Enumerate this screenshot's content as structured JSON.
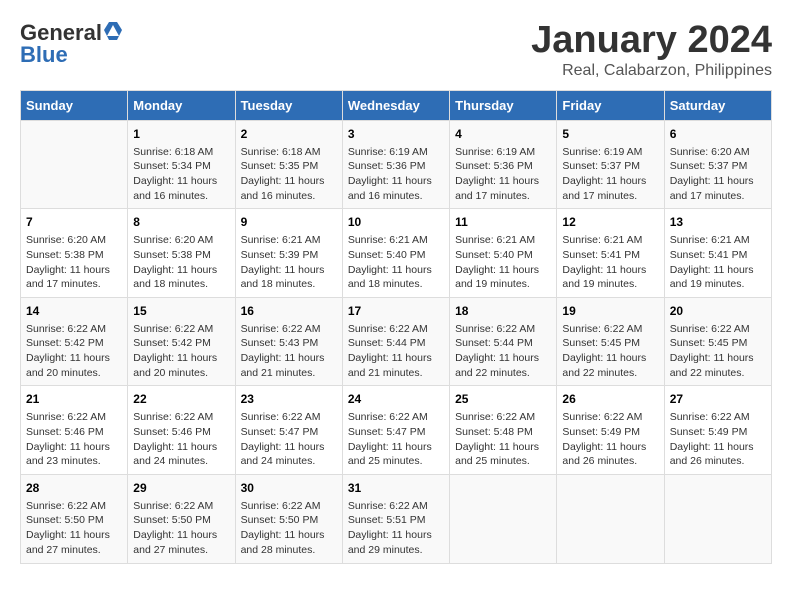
{
  "logo": {
    "general": "General",
    "blue": "Blue"
  },
  "title": "January 2024",
  "subtitle": "Real, Calabarzon, Philippines",
  "days": [
    "Sunday",
    "Monday",
    "Tuesday",
    "Wednesday",
    "Thursday",
    "Friday",
    "Saturday"
  ],
  "weeks": [
    [
      {
        "day": "",
        "content": ""
      },
      {
        "day": "1",
        "content": "Sunrise: 6:18 AM\nSunset: 5:34 PM\nDaylight: 11 hours\nand 16 minutes."
      },
      {
        "day": "2",
        "content": "Sunrise: 6:18 AM\nSunset: 5:35 PM\nDaylight: 11 hours\nand 16 minutes."
      },
      {
        "day": "3",
        "content": "Sunrise: 6:19 AM\nSunset: 5:36 PM\nDaylight: 11 hours\nand 16 minutes."
      },
      {
        "day": "4",
        "content": "Sunrise: 6:19 AM\nSunset: 5:36 PM\nDaylight: 11 hours\nand 17 minutes."
      },
      {
        "day": "5",
        "content": "Sunrise: 6:19 AM\nSunset: 5:37 PM\nDaylight: 11 hours\nand 17 minutes."
      },
      {
        "day": "6",
        "content": "Sunrise: 6:20 AM\nSunset: 5:37 PM\nDaylight: 11 hours\nand 17 minutes."
      }
    ],
    [
      {
        "day": "7",
        "content": "Sunrise: 6:20 AM\nSunset: 5:38 PM\nDaylight: 11 hours\nand 17 minutes."
      },
      {
        "day": "8",
        "content": "Sunrise: 6:20 AM\nSunset: 5:38 PM\nDaylight: 11 hours\nand 18 minutes."
      },
      {
        "day": "9",
        "content": "Sunrise: 6:21 AM\nSunset: 5:39 PM\nDaylight: 11 hours\nand 18 minutes."
      },
      {
        "day": "10",
        "content": "Sunrise: 6:21 AM\nSunset: 5:40 PM\nDaylight: 11 hours\nand 18 minutes."
      },
      {
        "day": "11",
        "content": "Sunrise: 6:21 AM\nSunset: 5:40 PM\nDaylight: 11 hours\nand 19 minutes."
      },
      {
        "day": "12",
        "content": "Sunrise: 6:21 AM\nSunset: 5:41 PM\nDaylight: 11 hours\nand 19 minutes."
      },
      {
        "day": "13",
        "content": "Sunrise: 6:21 AM\nSunset: 5:41 PM\nDaylight: 11 hours\nand 19 minutes."
      }
    ],
    [
      {
        "day": "14",
        "content": "Sunrise: 6:22 AM\nSunset: 5:42 PM\nDaylight: 11 hours\nand 20 minutes."
      },
      {
        "day": "15",
        "content": "Sunrise: 6:22 AM\nSunset: 5:42 PM\nDaylight: 11 hours\nand 20 minutes."
      },
      {
        "day": "16",
        "content": "Sunrise: 6:22 AM\nSunset: 5:43 PM\nDaylight: 11 hours\nand 21 minutes."
      },
      {
        "day": "17",
        "content": "Sunrise: 6:22 AM\nSunset: 5:44 PM\nDaylight: 11 hours\nand 21 minutes."
      },
      {
        "day": "18",
        "content": "Sunrise: 6:22 AM\nSunset: 5:44 PM\nDaylight: 11 hours\nand 22 minutes."
      },
      {
        "day": "19",
        "content": "Sunrise: 6:22 AM\nSunset: 5:45 PM\nDaylight: 11 hours\nand 22 minutes."
      },
      {
        "day": "20",
        "content": "Sunrise: 6:22 AM\nSunset: 5:45 PM\nDaylight: 11 hours\nand 22 minutes."
      }
    ],
    [
      {
        "day": "21",
        "content": "Sunrise: 6:22 AM\nSunset: 5:46 PM\nDaylight: 11 hours\nand 23 minutes."
      },
      {
        "day": "22",
        "content": "Sunrise: 6:22 AM\nSunset: 5:46 PM\nDaylight: 11 hours\nand 24 minutes."
      },
      {
        "day": "23",
        "content": "Sunrise: 6:22 AM\nSunset: 5:47 PM\nDaylight: 11 hours\nand 24 minutes."
      },
      {
        "day": "24",
        "content": "Sunrise: 6:22 AM\nSunset: 5:47 PM\nDaylight: 11 hours\nand 25 minutes."
      },
      {
        "day": "25",
        "content": "Sunrise: 6:22 AM\nSunset: 5:48 PM\nDaylight: 11 hours\nand 25 minutes."
      },
      {
        "day": "26",
        "content": "Sunrise: 6:22 AM\nSunset: 5:49 PM\nDaylight: 11 hours\nand 26 minutes."
      },
      {
        "day": "27",
        "content": "Sunrise: 6:22 AM\nSunset: 5:49 PM\nDaylight: 11 hours\nand 26 minutes."
      }
    ],
    [
      {
        "day": "28",
        "content": "Sunrise: 6:22 AM\nSunset: 5:50 PM\nDaylight: 11 hours\nand 27 minutes."
      },
      {
        "day": "29",
        "content": "Sunrise: 6:22 AM\nSunset: 5:50 PM\nDaylight: 11 hours\nand 27 minutes."
      },
      {
        "day": "30",
        "content": "Sunrise: 6:22 AM\nSunset: 5:50 PM\nDaylight: 11 hours\nand 28 minutes."
      },
      {
        "day": "31",
        "content": "Sunrise: 6:22 AM\nSunset: 5:51 PM\nDaylight: 11 hours\nand 29 minutes."
      },
      {
        "day": "",
        "content": ""
      },
      {
        "day": "",
        "content": ""
      },
      {
        "day": "",
        "content": ""
      }
    ]
  ]
}
